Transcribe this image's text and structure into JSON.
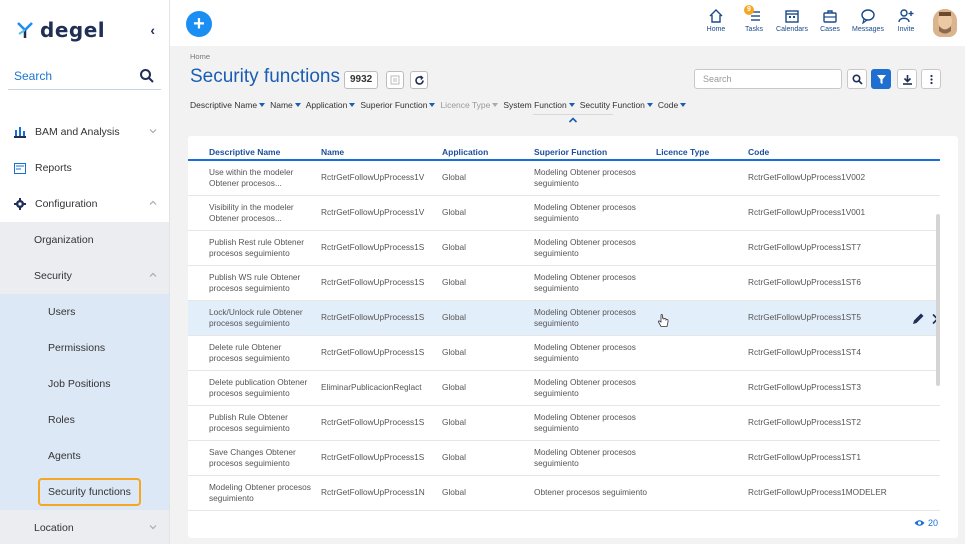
{
  "sidebar": {
    "logo_text": "degel",
    "collapse_glyph": "‹",
    "search_label": "Search",
    "items": [
      {
        "label": "BAM and Analysis",
        "icon": "bar-chart-icon"
      },
      {
        "label": "Reports",
        "icon": "report-icon"
      },
      {
        "label": "Configuration",
        "icon": "gear-icon"
      },
      {
        "label": "Organization"
      },
      {
        "label": "Security"
      },
      {
        "label": "Users"
      },
      {
        "label": "Permissions"
      },
      {
        "label": "Job Positions"
      },
      {
        "label": "Roles"
      },
      {
        "label": "Agents"
      },
      {
        "label": "Security functions"
      },
      {
        "label": "Location"
      }
    ]
  },
  "topbar": {
    "add_glyph": "+",
    "nav": [
      {
        "label": "Home",
        "icon": "home-icon"
      },
      {
        "label": "Tasks",
        "icon": "tasks-icon",
        "badge": "9"
      },
      {
        "label": "Calendars",
        "icon": "calendar-icon"
      },
      {
        "label": "Cases",
        "icon": "briefcase-icon"
      },
      {
        "label": "Messages",
        "icon": "chat-icon"
      },
      {
        "label": "Invite",
        "icon": "add-user-icon"
      }
    ]
  },
  "header": {
    "breadcrumb": "Home",
    "title": "Security functions",
    "count": "9932",
    "search_placeholder": "Search"
  },
  "filters": [
    {
      "label": "Descriptive Name",
      "muted": false
    },
    {
      "label": "Name",
      "muted": false
    },
    {
      "label": "Application",
      "muted": false
    },
    {
      "label": "Superior Function",
      "muted": false
    },
    {
      "label": "Licence Type",
      "muted": true
    },
    {
      "label": "System Function",
      "muted": false
    },
    {
      "label": "Secutity Function",
      "muted": false
    },
    {
      "label": "Code",
      "muted": false
    }
  ],
  "table": {
    "columns": [
      "Descriptive Name",
      "Name",
      "Application",
      "Superior Function",
      "Licence Type",
      "Code"
    ],
    "rows": [
      [
        "Use within the modeler Obtener procesos...",
        "RctrGetFollowUpProcess1V",
        "Global",
        "Modeling Obtener procesos seguimiento",
        "",
        "RctrGetFollowUpProcess1V002"
      ],
      [
        "Visibility in the modeler Obtener procesos...",
        "RctrGetFollowUpProcess1V",
        "Global",
        "Modeling Obtener procesos seguimiento",
        "",
        "RctrGetFollowUpProcess1V001"
      ],
      [
        "Publish Rest rule Obtener procesos seguimiento",
        "RctrGetFollowUpProcess1S",
        "Global",
        "Modeling Obtener procesos seguimiento",
        "",
        "RctrGetFollowUpProcess1ST7"
      ],
      [
        "Publish WS rule Obtener procesos seguimiento",
        "RctrGetFollowUpProcess1S",
        "Global",
        "Modeling Obtener procesos seguimiento",
        "",
        "RctrGetFollowUpProcess1ST6"
      ],
      [
        "Lock/Unlock rule Obtener procesos seguimiento",
        "RctrGetFollowUpProcess1S",
        "Global",
        "Modeling Obtener procesos seguimiento",
        "",
        "RctrGetFollowUpProcess1ST5"
      ],
      [
        "Delete rule Obtener procesos seguimiento",
        "RctrGetFollowUpProcess1S",
        "Global",
        "Modeling Obtener procesos seguimiento",
        "",
        "RctrGetFollowUpProcess1ST4"
      ],
      [
        "Delete publication Obtener procesos seguimiento",
        "EliminarPublicacionReglact",
        "Global",
        "Modeling Obtener procesos seguimiento",
        "",
        "RctrGetFollowUpProcess1ST3"
      ],
      [
        "Publish Rule Obtener procesos seguimiento",
        "RctrGetFollowUpProcess1S",
        "Global",
        "Modeling Obtener procesos seguimiento",
        "",
        "RctrGetFollowUpProcess1ST2"
      ],
      [
        "Save Changes Obtener procesos seguimiento",
        "RctrGetFollowUpProcess1S",
        "Global",
        "Modeling Obtener procesos seguimiento",
        "",
        "RctrGetFollowUpProcess1ST1"
      ],
      [
        "Modeling Obtener procesos seguimiento",
        "RctrGetFollowUpProcess1N",
        "Global",
        "Obtener procesos seguimiento",
        "",
        "RctrGetFollowUpProcess1MODELER"
      ]
    ],
    "highlighted_row": 4,
    "page_size": "20"
  },
  "colors": {
    "accent": "#1a6fd6",
    "title": "#1b5db3",
    "highlight_border": "#f5a623",
    "row_highlight": "#e3eefb"
  }
}
